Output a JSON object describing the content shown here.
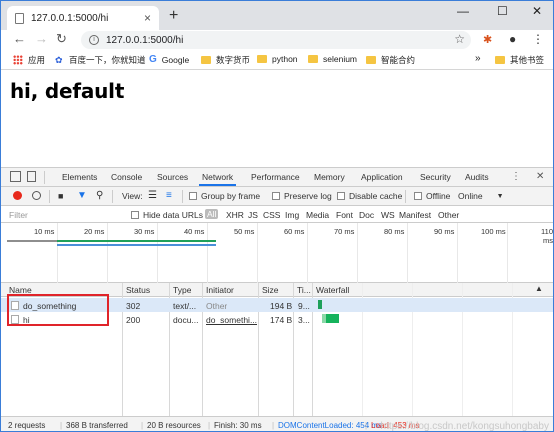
{
  "tab": {
    "title": "127.0.0.1:5000/hi",
    "close": "×",
    "new_tab": "+"
  },
  "window_controls": {
    "minimize": "—",
    "maximize": "☐",
    "close": "✕"
  },
  "address": {
    "url": "127.0.0.1:5000/hi",
    "info": "i",
    "star": "☆",
    "menu": "⋮"
  },
  "bookmarks": {
    "items": [
      {
        "label": "应用",
        "icon": "apps-icon"
      },
      {
        "label": "百度一下，你就知道",
        "icon": "baidu-icon"
      },
      {
        "label": "Google",
        "icon": "google-icon"
      },
      {
        "label": "数字货币",
        "icon": "folder-icon"
      },
      {
        "label": "python",
        "icon": "folder-icon"
      },
      {
        "label": "selenium",
        "icon": "folder-icon"
      },
      {
        "label": "智能合约",
        "icon": "folder-icon"
      }
    ],
    "overflow": "»",
    "other": "其他书签"
  },
  "page": {
    "heading": "hi, default"
  },
  "devtools": {
    "tabs": [
      "Elements",
      "Console",
      "Sources",
      "Network",
      "Performance",
      "Memory",
      "Application",
      "Security",
      "Audits"
    ],
    "active_tab": "Network",
    "more": "⋮",
    "close": "✕",
    "controls": {
      "view_label": "View:",
      "group_by_frame": "Group by frame",
      "preserve_log": "Preserve log",
      "disable_cache": "Disable cache",
      "offline": "Offline",
      "throttle": "Online"
    },
    "filter": {
      "placeholder": "Filter",
      "hide_data_urls": "Hide data URLs",
      "types": [
        "All",
        "XHR",
        "JS",
        "CSS",
        "Img",
        "Media",
        "Font",
        "Doc",
        "WS",
        "Manifest",
        "Other"
      ]
    },
    "overview_ticks": [
      "10 ms",
      "20 ms",
      "30 ms",
      "40 ms",
      "50 ms",
      "60 ms",
      "70 ms",
      "80 ms",
      "90 ms",
      "100 ms",
      "110 ms"
    ],
    "columns": [
      "Name",
      "Status",
      "Type",
      "Initiator",
      "Size",
      "Ti...",
      "Waterfall"
    ],
    "rows": [
      {
        "name": "do_something",
        "status": "302",
        "type": "text/...",
        "initiator": "Other",
        "size": "194 B",
        "time": "9..."
      },
      {
        "name": "hi",
        "status": "200",
        "type": "docu...",
        "initiator": "do_somethi...",
        "size": "174 B",
        "time": "3..."
      }
    ],
    "status_bar": {
      "requests": "2 requests",
      "transferred": "368 B transferred",
      "resources": "20 B resources",
      "finish": "Finish: 30 ms",
      "dom": "DOMContentLoaded: 454 ms",
      "load": "Load: 453 ms",
      "watermark": "https://blog.csdn.net/kongsuhongbaby"
    }
  },
  "colors": {
    "accent": "#1a73e8",
    "record": "#e8291c",
    "highlight_box": "#e0242a",
    "dom_blue": "#1a73e8",
    "load_red": "#e8291c"
  }
}
